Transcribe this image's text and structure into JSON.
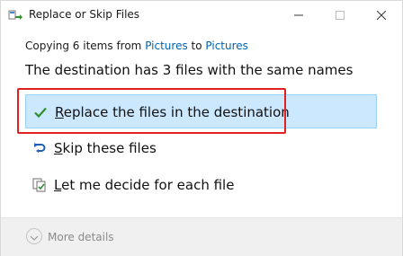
{
  "window": {
    "title": "Replace or Skip Files"
  },
  "copy": {
    "prefix": "Copying 6 items from ",
    "source": "Pictures",
    "middle": " to ",
    "destination": "Pictures"
  },
  "message": "The destination has 3 files with the same names",
  "options": [
    {
      "key": "R",
      "rest": "eplace the files in the destination",
      "icon": "checkmark-icon",
      "selected": true
    },
    {
      "key": "S",
      "rest": "kip these files",
      "icon": "skip-arrow-icon",
      "selected": false
    },
    {
      "key": "L",
      "rest": "et me decide for each file",
      "icon": "compare-files-icon",
      "selected": false
    }
  ],
  "footer": {
    "more_details": "More details"
  },
  "colors": {
    "link": "#0063b1",
    "selected_bg": "#cce8ff",
    "selected_border": "#99d1ff",
    "highlight": "#e02020",
    "check": "#2f8f2f"
  }
}
